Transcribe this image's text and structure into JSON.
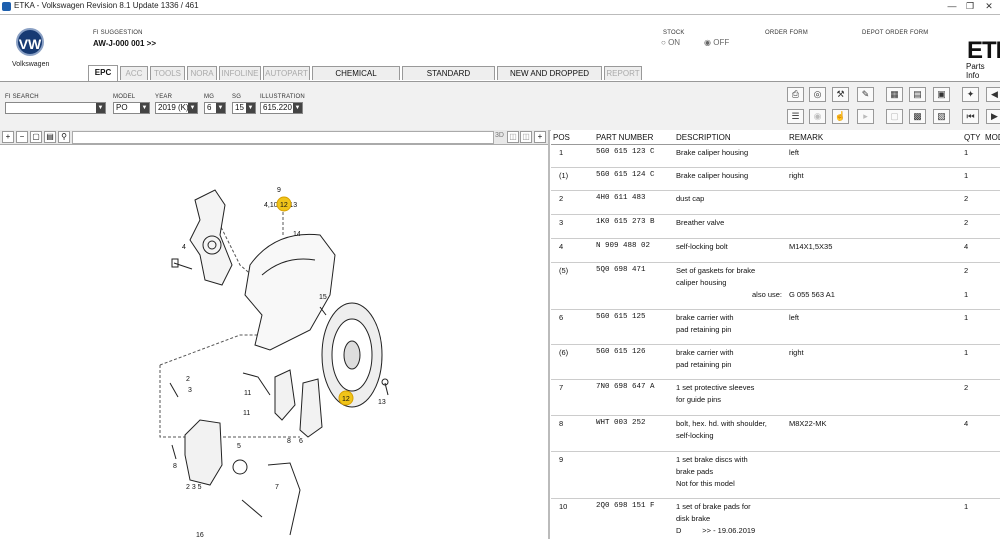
{
  "window": {
    "title": "ETKA - Volkswagen Revision 8.1 Update 1336 / 461"
  },
  "brand": {
    "name": "Volkswagen",
    "logo_text": "VW",
    "product": "ETK",
    "product_sub": "Parts Info"
  },
  "header": {
    "fi_suggestion_label": "FI SUGGESTION",
    "fi_suggestion_value": "AW-J-000 001 >>",
    "stock_label": "STOCK",
    "stock_on": "ON",
    "stock_off": "OFF",
    "order_form_label": "ORDER FORM",
    "depot_order_form_label": "DEPOT ORDER FORM"
  },
  "tabs": [
    {
      "label": "EPC",
      "active": true,
      "enabled": true
    },
    {
      "label": "ACC",
      "enabled": false
    },
    {
      "label": "TOOLS",
      "enabled": false
    },
    {
      "label": "NORA",
      "enabled": false
    },
    {
      "label": "INFOLINE",
      "enabled": false
    },
    {
      "label": "AUTOPART",
      "enabled": false
    },
    {
      "label": "CHEMICAL MATERIALS",
      "enabled": true
    },
    {
      "label": "STANDARD HARDWARE",
      "enabled": true
    },
    {
      "label": "NEW AND DROPPED PARTS",
      "enabled": true
    },
    {
      "label": "REPORT",
      "enabled": false
    }
  ],
  "filters": {
    "fi_search_label": "FI SEARCH",
    "fi_search_value": "",
    "model_label": "MODEL",
    "model_value": "PO",
    "year_label": "YEAR",
    "year_value": "2019 (K)",
    "mg_label": "MG",
    "mg_value": "6",
    "sg_label": "SG",
    "sg_value": "15",
    "illustration_label": "ILLUSTRATION",
    "illustration_value": "615.220"
  },
  "diagram": {
    "view_3d_label": "3D",
    "callouts": [
      "9",
      "4,10,12,13",
      "14",
      "4",
      "15",
      "2",
      "3",
      "11",
      "12",
      "13",
      "11",
      "8",
      "6",
      "5",
      "8",
      "2 3 5",
      "7",
      "16"
    ]
  },
  "parts_table": {
    "columns": [
      "POS",
      "PART NUMBER",
      "DESCRIPTION",
      "REMARK",
      "QTY",
      "MOD"
    ],
    "rows": [
      {
        "pos": "1",
        "part": "5G0 615 123 C",
        "desc": [
          "Brake caliper housing"
        ],
        "remark": "left",
        "qty": "1"
      },
      {
        "pos": "(1)",
        "part": "5G0 615 124 C",
        "desc": [
          "Brake caliper housing"
        ],
        "remark": "right",
        "qty": "1"
      },
      {
        "pos": "2",
        "part": "4H0 611 483",
        "desc": [
          "dust cap"
        ],
        "remark": "",
        "qty": "2"
      },
      {
        "pos": "3",
        "part": "1K0 615 273 B",
        "desc": [
          "Breather valve"
        ],
        "remark": "",
        "qty": "2"
      },
      {
        "pos": "4",
        "part": "N    909 488 02",
        "desc": [
          "self-locking bolt"
        ],
        "remark": "M14X1,5X35",
        "qty": "4"
      },
      {
        "pos": "(5)",
        "part": "5Q0 698 471",
        "desc": [
          "Set of gaskets for brake",
          "caliper housing"
        ],
        "remark": "",
        "qty": "2",
        "also_use": "also use:",
        "also_part": "G  055 563 A1",
        "also_qty": "1"
      },
      {
        "pos": "6",
        "part": "5G0 615 125",
        "desc": [
          "brake carrier with",
          "pad retaining pin"
        ],
        "remark": "left",
        "qty": "1"
      },
      {
        "pos": "(6)",
        "part": "5G0 615 126",
        "desc": [
          "brake carrier with",
          "pad retaining pin"
        ],
        "remark": "right",
        "qty": "1"
      },
      {
        "pos": "7",
        "part": "7N0 698 647 A",
        "desc": [
          "1 set protective sleeves",
          "for guide pins"
        ],
        "remark": "",
        "qty": "2"
      },
      {
        "pos": "8",
        "part": "WHT 003 252",
        "desc": [
          "bolt, hex. hd. with shoulder,",
          "self-locking"
        ],
        "remark": "M8X22-MK",
        "qty": "4"
      },
      {
        "pos": "9",
        "part": "",
        "desc": [
          "1 set brake discs with",
          "brake pads",
          "Not for this model"
        ],
        "remark": "",
        "qty": ""
      },
      {
        "pos": "10",
        "part": "2Q0 698 151 F",
        "desc": [
          "1 set of brake pads for",
          "disk brake",
          "D          >> - 19.06.2019"
        ],
        "remark": "",
        "qty": "1"
      }
    ]
  },
  "colors": {
    "accent_callout": "#f0c419",
    "tab_border": "#999999",
    "header_bg": "#ffffff"
  }
}
